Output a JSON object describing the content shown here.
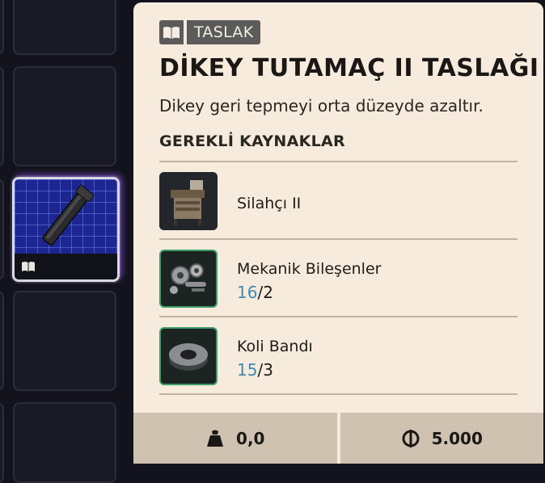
{
  "item": {
    "tag_label": "TASLAK",
    "title": "DİKEY TUTAMAÇ II TASLAĞI",
    "description": "Dikey geri tepmeyi orta düzeyde azaltır.",
    "section_heading": "GEREKLİ KAYNAKLAR"
  },
  "resources": [
    {
      "name": "Silahçı II",
      "icon": "workbench-icon",
      "have": "",
      "need": ""
    },
    {
      "name": "Mekanik Bileşenler",
      "icon": "mechanical-parts-icon",
      "have": "16",
      "need": "2"
    },
    {
      "name": "Koli Bandı",
      "icon": "duct-tape-icon",
      "have": "15",
      "need": "3"
    }
  ],
  "footer": {
    "weight": "0,0",
    "weight_icon": "weight-icon",
    "price": "5.000",
    "price_icon": "coin-icon"
  },
  "colors": {
    "panel_bg": "#f6ebdc",
    "tag_bg": "#5b5b5b",
    "quantity_have": "#3d8ab2",
    "rare_border": "#3f9c68",
    "footer_bg": "#cfc2b1",
    "grid_bg": "#12131c"
  }
}
